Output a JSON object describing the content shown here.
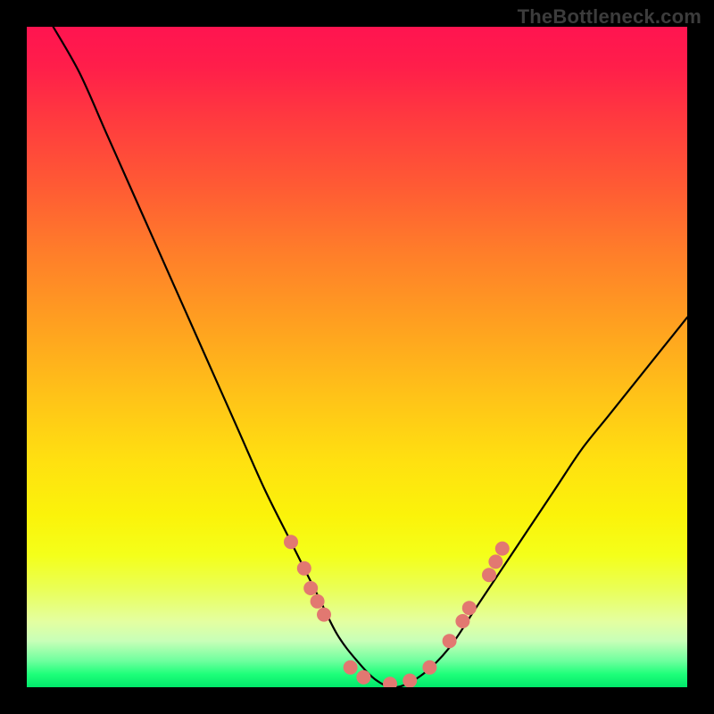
{
  "watermark": "TheBottleneck.com",
  "colors": {
    "frame": "#000000",
    "curve": "#000000",
    "dots": "#e27871",
    "gradient_top": "#ff1450",
    "gradient_bottom": "#00e86a"
  },
  "chart_data": {
    "type": "line",
    "title": "",
    "xlabel": "",
    "ylabel": "",
    "xlim": [
      0,
      100
    ],
    "ylim": [
      0,
      100
    ],
    "annotations": [],
    "series": [
      {
        "name": "bottleneck-curve",
        "x": [
          4,
          8,
          12,
          16,
          20,
          24,
          28,
          32,
          36,
          40,
          44,
          47,
          50,
          53,
          56,
          60,
          64,
          68,
          72,
          76,
          80,
          84,
          88,
          92,
          96,
          100
        ],
        "y": [
          100,
          93,
          84,
          75,
          66,
          57,
          48,
          39,
          30,
          22,
          14,
          8,
          4,
          1,
          0,
          2,
          6,
          12,
          18,
          24,
          30,
          36,
          41,
          46,
          51,
          56
        ]
      }
    ],
    "dots": [
      {
        "x": 40,
        "y": 22
      },
      {
        "x": 42,
        "y": 18
      },
      {
        "x": 43,
        "y": 15
      },
      {
        "x": 44,
        "y": 13
      },
      {
        "x": 45,
        "y": 11
      },
      {
        "x": 49,
        "y": 3
      },
      {
        "x": 51,
        "y": 1.5
      },
      {
        "x": 55,
        "y": 0.5
      },
      {
        "x": 58,
        "y": 1
      },
      {
        "x": 61,
        "y": 3
      },
      {
        "x": 64,
        "y": 7
      },
      {
        "x": 66,
        "y": 10
      },
      {
        "x": 67,
        "y": 12
      },
      {
        "x": 70,
        "y": 17
      },
      {
        "x": 71,
        "y": 19
      },
      {
        "x": 72,
        "y": 21
      }
    ]
  }
}
